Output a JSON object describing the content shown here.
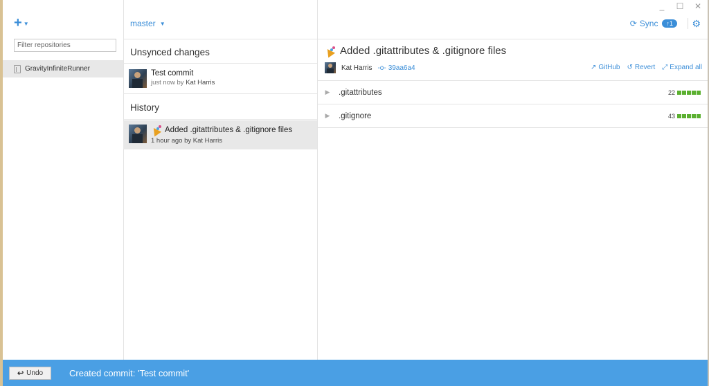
{
  "window": {
    "controls": {
      "minimize": "_",
      "maximize": "☐",
      "close": "✕"
    }
  },
  "sidebar": {
    "add_icon": "plus-icon",
    "filter_placeholder": "Filter repositories",
    "repositories": [
      {
        "name": "GravityInfiniteRunner",
        "icon": "repo-icon",
        "selected": true
      }
    ]
  },
  "branch": {
    "name": "master"
  },
  "header": {
    "sync_label": "Sync",
    "sync_badge": "↑1",
    "settings_icon": "gear-icon"
  },
  "unsynced": {
    "title": "Unsynced changes",
    "commits": [
      {
        "title": "Test commit",
        "when": "just now",
        "by": "by",
        "author": "Kat Harris"
      }
    ]
  },
  "history": {
    "title": "History",
    "commits": [
      {
        "title": "Added .gitattributes & .gitignore files",
        "when": "1 hour ago",
        "by": "by",
        "author": "Kat Harris",
        "selected": true
      }
    ]
  },
  "detail": {
    "title": "Added .gitattributes & .gitignore files",
    "author": "Kat Harris",
    "sha": "39aa6a4",
    "actions": {
      "github": "GitHub",
      "revert": "Revert",
      "expand": "Expand all"
    },
    "files": [
      {
        "name": ".gitattributes",
        "additions": "22"
      },
      {
        "name": ".gitignore",
        "additions": "43"
      }
    ]
  },
  "status": {
    "undo_label": "Undo",
    "message": "Created commit: 'Test commit'"
  },
  "colors": {
    "accent": "#3b8ed8",
    "status_bar": "#4a9fe4",
    "addition": "#5bb030"
  }
}
